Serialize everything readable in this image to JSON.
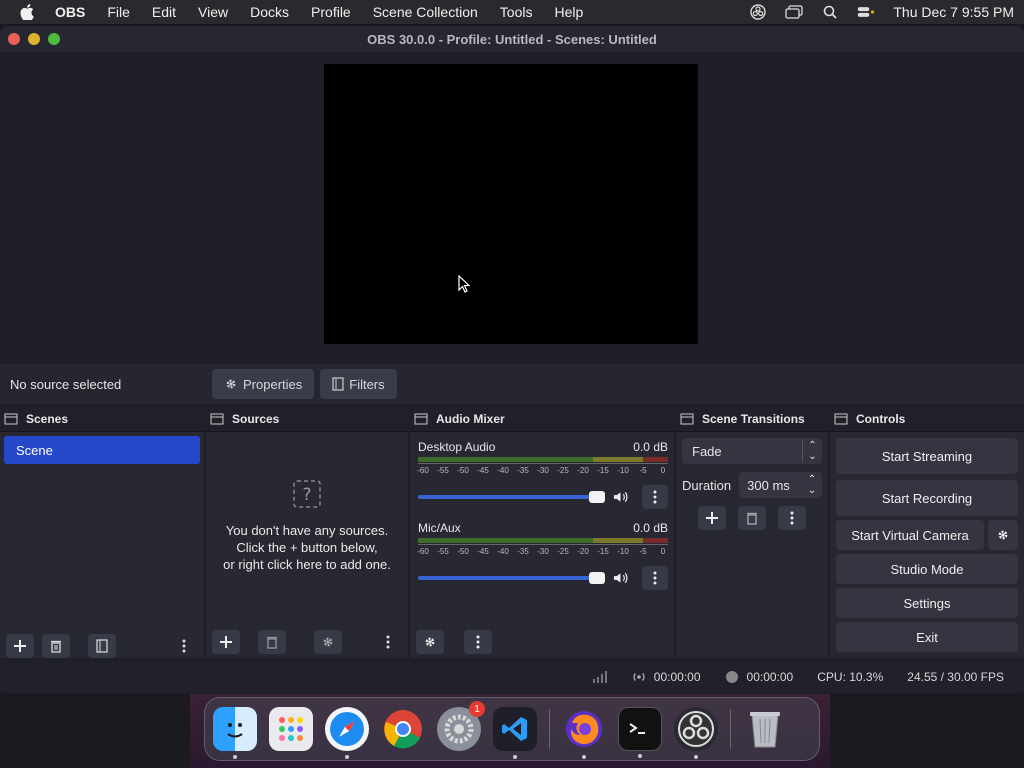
{
  "menubar": {
    "items": [
      "OBS",
      "File",
      "Edit",
      "View",
      "Docks",
      "Profile",
      "Scene Collection",
      "Tools",
      "Help"
    ],
    "clock": "Thu Dec 7  9:55 PM"
  },
  "window": {
    "title": "OBS 30.0.0 - Profile: Untitled - Scenes: Untitled"
  },
  "source_bar": {
    "no_source": "No source selected",
    "properties": "Properties",
    "filters": "Filters"
  },
  "scenes": {
    "title": "Scenes",
    "items": [
      "Scene"
    ]
  },
  "sources": {
    "title": "Sources",
    "empty_line1": "You don't have any sources.",
    "empty_line2": "Click the + button below,",
    "empty_line3": "or right click here to add one."
  },
  "mixer": {
    "title": "Audio Mixer",
    "channels": [
      {
        "name": "Desktop Audio",
        "level": "0.0 dB"
      },
      {
        "name": "Mic/Aux",
        "level": "0.0 dB"
      }
    ],
    "ticks": [
      "-60",
      "-55",
      "-50",
      "-45",
      "-40",
      "-35",
      "-30",
      "-25",
      "-20",
      "-15",
      "-10",
      "-5",
      "0"
    ]
  },
  "transitions": {
    "title": "Scene Transitions",
    "selected": "Fade",
    "duration_label": "Duration",
    "duration_value": "300 ms"
  },
  "controls": {
    "title": "Controls",
    "start_streaming": "Start Streaming",
    "start_recording": "Start Recording",
    "start_virtual_camera": "Start Virtual Camera",
    "studio_mode": "Studio Mode",
    "settings": "Settings",
    "exit": "Exit"
  },
  "status": {
    "stream_time": "00:00:00",
    "record_time": "00:00:00",
    "cpu": "CPU: 10.3%",
    "fps": "24.55 / 30.00 FPS"
  },
  "dock": {
    "settings_badge": "1"
  },
  "colors": {
    "accent": "#2448c7",
    "slider": "#3a63d6"
  }
}
